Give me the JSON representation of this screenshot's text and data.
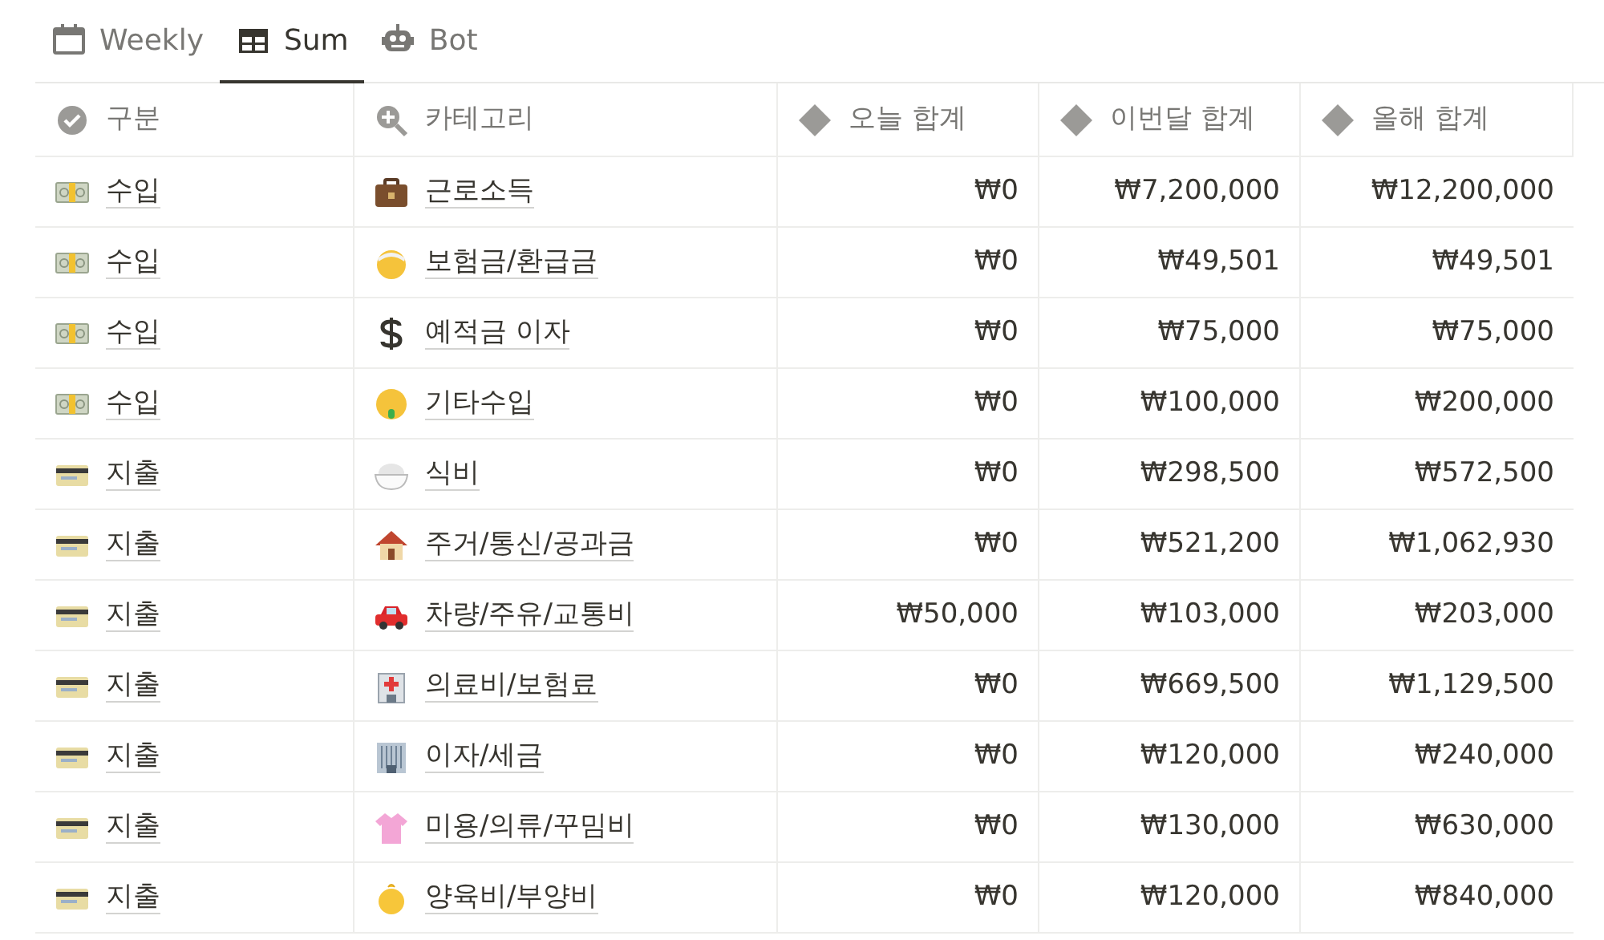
{
  "tabs": [
    {
      "label": "Weekly",
      "selected": false
    },
    {
      "label": "Sum",
      "selected": true
    },
    {
      "label": "Bot",
      "selected": false
    }
  ],
  "table": {
    "columns": [
      {
        "label": "구분"
      },
      {
        "label": "카테고리"
      },
      {
        "label": "오늘 합계"
      },
      {
        "label": "이번달 합계"
      },
      {
        "label": "올해 합계"
      }
    ],
    "rows": [
      {
        "type": {
          "label": "수입",
          "kind": "income"
        },
        "category": "근로소득",
        "today": "₩0",
        "month": "₩7,200,000",
        "year": "₩12,200,000"
      },
      {
        "type": {
          "label": "수입",
          "kind": "income"
        },
        "category": "보험금/환급금",
        "today": "₩0",
        "month": "₩49,501",
        "year": "₩49,501"
      },
      {
        "type": {
          "label": "수입",
          "kind": "income"
        },
        "category": "예적금 이자",
        "today": "₩0",
        "month": "₩75,000",
        "year": "₩75,000"
      },
      {
        "type": {
          "label": "수입",
          "kind": "income"
        },
        "category": "기타수입",
        "today": "₩0",
        "month": "₩100,000",
        "year": "₩200,000"
      },
      {
        "type": {
          "label": "지출",
          "kind": "expense"
        },
        "category": "식비",
        "today": "₩0",
        "month": "₩298,500",
        "year": "₩572,500"
      },
      {
        "type": {
          "label": "지출",
          "kind": "expense"
        },
        "category": "주거/통신/공과금",
        "today": "₩0",
        "month": "₩521,200",
        "year": "₩1,062,930"
      },
      {
        "type": {
          "label": "지출",
          "kind": "expense"
        },
        "category": "차량/주유/교통비",
        "today": "₩50,000",
        "month": "₩103,000",
        "year": "₩203,000"
      },
      {
        "type": {
          "label": "지출",
          "kind": "expense"
        },
        "category": "의료비/보험료",
        "today": "₩0",
        "month": "₩669,500",
        "year": "₩1,129,500"
      },
      {
        "type": {
          "label": "지출",
          "kind": "expense"
        },
        "category": "이자/세금",
        "today": "₩0",
        "month": "₩120,000",
        "year": "₩240,000"
      },
      {
        "type": {
          "label": "지출",
          "kind": "expense"
        },
        "category": "미용/의류/꾸밈비",
        "today": "₩0",
        "month": "₩130,000",
        "year": "₩630,000"
      },
      {
        "type": {
          "label": "지출",
          "kind": "expense"
        },
        "category": "양육비/부양비",
        "today": "₩0",
        "month": "₩120,000",
        "year": "₩840,000"
      }
    ]
  }
}
